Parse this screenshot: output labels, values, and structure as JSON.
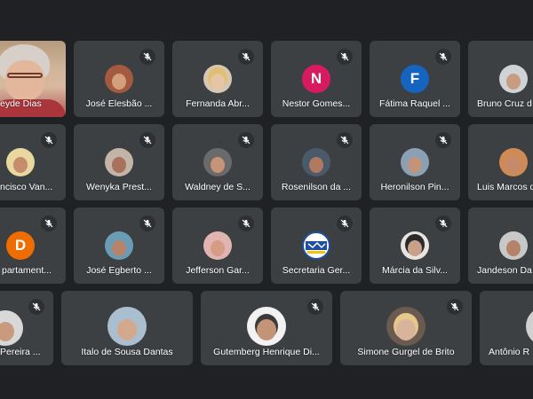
{
  "participants": [
    {
      "name": "eyde Dias",
      "kind": "video"
    },
    {
      "name": "José Elesbão ...",
      "kind": "photo",
      "bg": "#a35a3e",
      "skin": "#d4a07c"
    },
    {
      "name": "Fernanda Abr...",
      "kind": "photo",
      "bg": "#d6c7b5",
      "skin": "#e8c4a6"
    },
    {
      "name": "Nestor Gomes...",
      "kind": "initial",
      "initial": "N",
      "color": "#d81b60"
    },
    {
      "name": "Fátima Raquel ...",
      "kind": "initial",
      "initial": "F",
      "color": "#1565c0"
    },
    {
      "name": "Bruno Cruz d",
      "kind": "photo",
      "bg": "#cfd3d6",
      "skin": "#c89c80"
    },
    {
      "name": "ncisco Van...",
      "kind": "photo",
      "bg": "#e8d8a0",
      "skin": "#c78c6a"
    },
    {
      "name": "Wenyka Prest...",
      "kind": "photo",
      "bg": "#c3b4a8",
      "skin": "#a9705b"
    },
    {
      "name": "Waldney de S...",
      "kind": "photo",
      "bg": "#6a6a6a",
      "skin": "#c69578"
    },
    {
      "name": "Rosenilson da ...",
      "kind": "photo",
      "bg": "#4a5a6a",
      "skin": "#b07a60"
    },
    {
      "name": "Heronilson Pin...",
      "kind": "photo",
      "bg": "#8aa0b4",
      "skin": "#c49478"
    },
    {
      "name": "Luis Marcos d",
      "kind": "photo",
      "bg": "#d08a56",
      "skin": "#c58a6c"
    },
    {
      "name": "partament...",
      "kind": "initial",
      "initial": "D",
      "color": "#ef6c00"
    },
    {
      "name": "José Egberto ...",
      "kind": "photo",
      "bg": "#6b9cb6",
      "skin": "#b9836a"
    },
    {
      "name": "Jefferson Gar...",
      "kind": "photo",
      "bg": "#e0b4b0",
      "skin": "#d79c86"
    },
    {
      "name": "Secretaria Ger...",
      "kind": "logo",
      "bg": "#1f4fa0"
    },
    {
      "name": "Márcia da Silv...",
      "kind": "photo",
      "bg": "#e8e4e0",
      "skin": "#c9a08a"
    },
    {
      "name": "Jandeson Da",
      "kind": "photo",
      "bg": "#c8c8c8",
      "skin": "#b6826a"
    },
    {
      "name": "Pereira ...",
      "kind": "photo",
      "bg": "#d8d8d8",
      "skin": "#c99a7e"
    },
    {
      "name": "Italo de Sousa Dantas",
      "kind": "photo",
      "bg": "#a9bfd0",
      "skin": "#d4a88c"
    },
    {
      "name": "Gutemberg Henrique Di...",
      "kind": "photo",
      "bg": "#f2f2f2",
      "skin": "#c49478"
    },
    {
      "name": "Simone Gurgel de Brito",
      "kind": "photo",
      "bg": "#6a5a50",
      "skin": "#d8b49c"
    },
    {
      "name": "Antônio R",
      "kind": "photo",
      "bg": "#d0d0d0",
      "skin": "#c49478"
    }
  ],
  "icons": {
    "mic": "mic-off-icon"
  },
  "colors": {
    "background": "#202124",
    "tile": "#3c4043"
  }
}
